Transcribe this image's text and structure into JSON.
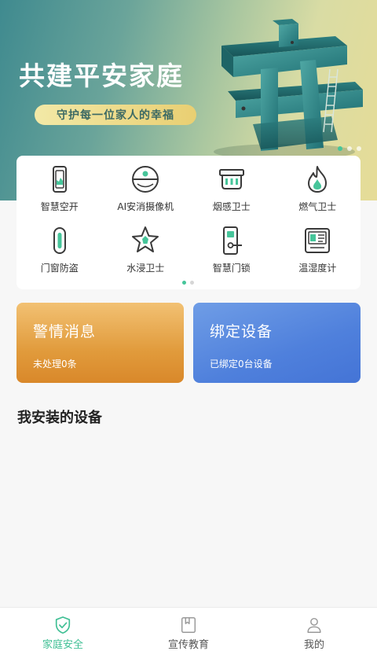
{
  "banner": {
    "title": "共建平安家庭",
    "slogan": "守护每一位家人的幸福",
    "art_char": "安",
    "dots": 3,
    "active_dot": 0
  },
  "devices": [
    {
      "label": "智慧空开",
      "icon": "smart-breaker-icon"
    },
    {
      "label": "AI安消摄像机",
      "icon": "camera-icon"
    },
    {
      "label": "烟感卫士",
      "icon": "smoke-detector-icon"
    },
    {
      "label": "燃气卫士",
      "icon": "gas-flame-icon"
    },
    {
      "label": "门窗防盗",
      "icon": "door-sensor-icon"
    },
    {
      "label": "水浸卫士",
      "icon": "water-leak-icon"
    },
    {
      "label": "智慧门锁",
      "icon": "door-lock-icon"
    },
    {
      "label": "温湿度计",
      "icon": "thermo-hygrometer-icon"
    }
  ],
  "alarm": {
    "title": "警情消息",
    "sub": "未处理0条"
  },
  "bind": {
    "title": "绑定设备",
    "sub": "已绑定0台设备"
  },
  "section": {
    "title": "我安装的设备"
  },
  "tabs": [
    {
      "label": "家庭安全",
      "icon": "shield-icon"
    },
    {
      "label": "宣传教育",
      "icon": "book-icon"
    },
    {
      "label": "我的",
      "icon": "user-icon"
    }
  ],
  "colors": {
    "accent": "#3fbf94",
    "alarm": "#e19b3c",
    "bind": "#4f80dc",
    "icon_dark": "#3a3a3a"
  }
}
